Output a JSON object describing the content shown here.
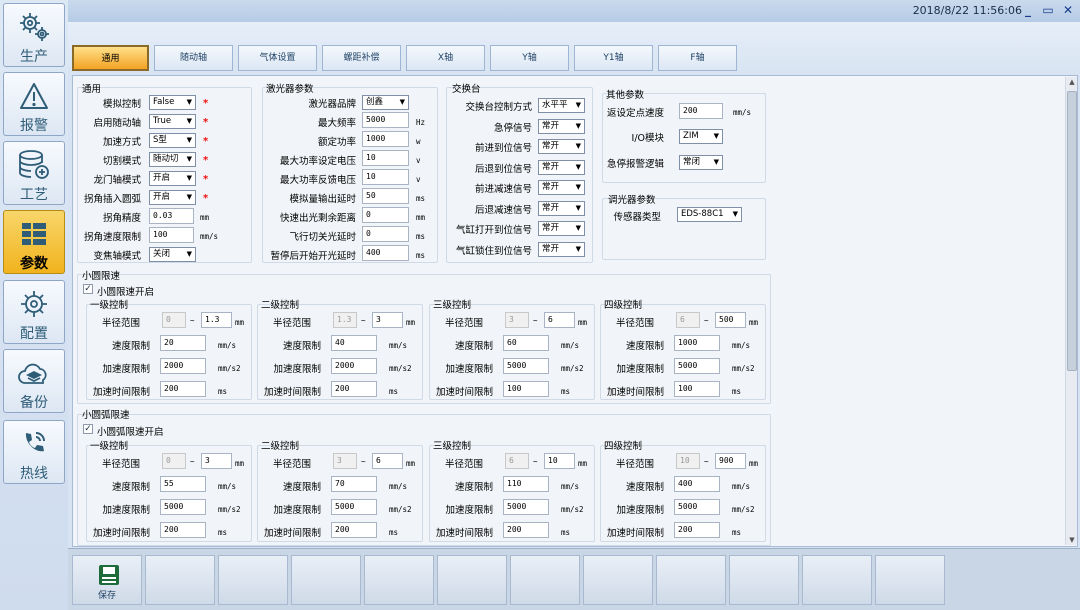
{
  "colors": {
    "accent": "#f1b31d",
    "brand": "#2f5d78",
    "required": "#ee1111"
  },
  "sidebar": {
    "items": [
      {
        "label": "生产",
        "icon": "gear-cluster-icon"
      },
      {
        "label": "报警",
        "icon": "warning-icon"
      },
      {
        "label": "工艺",
        "icon": "database-add-icon"
      },
      {
        "label": "参数",
        "icon": "grid-list-icon",
        "active": true
      },
      {
        "label": "配置",
        "icon": "gear-icon"
      },
      {
        "label": "备份",
        "icon": "cloud-backup-icon"
      },
      {
        "label": "热线",
        "icon": "phone-icon"
      }
    ]
  },
  "header": {
    "datetime": "2018/8/22 11:56:06"
  },
  "tabs": [
    "通用",
    "随动轴",
    "气体设置",
    "螺距补偿",
    "X轴",
    "Y轴",
    "Y1轴",
    "F轴"
  ],
  "general": {
    "title": "通用",
    "rows": [
      {
        "label": "模拟控制",
        "value": "False",
        "type": "dd",
        "req": "*"
      },
      {
        "label": "启用随动轴",
        "value": "True",
        "type": "dd",
        "req": "*"
      },
      {
        "label": "加速方式",
        "value": "S型",
        "type": "dd",
        "req": "*"
      },
      {
        "label": "切割模式",
        "value": "随动切",
        "type": "dd",
        "req": "*"
      },
      {
        "label": "龙门轴模式",
        "value": "开启",
        "type": "dd",
        "req": "*"
      },
      {
        "label": "拐角插入圆弧",
        "value": "开启",
        "type": "dd",
        "req": "*"
      },
      {
        "label": "拐角精度",
        "value": "0.03",
        "type": "tb",
        "unit": "mm"
      },
      {
        "label": "拐角速度限制",
        "value": "100",
        "type": "tb",
        "unit": "mm/s"
      },
      {
        "label": "变焦轴模式",
        "value": "关闭",
        "type": "dd"
      }
    ]
  },
  "laser": {
    "title": "激光器参数",
    "rows": [
      {
        "label": "激光器品牌",
        "value": "创鑫",
        "type": "dd"
      },
      {
        "label": "最大频率",
        "value": "5000",
        "type": "tb",
        "unit": "Hz"
      },
      {
        "label": "额定功率",
        "value": "1000",
        "type": "tb",
        "unit": "w"
      },
      {
        "label": "最大功率设定电压",
        "value": "10",
        "type": "tb",
        "unit": "v"
      },
      {
        "label": "最大功率反馈电压",
        "value": "10",
        "type": "tb",
        "unit": "v"
      },
      {
        "label": "模拟量输出延时",
        "value": "50",
        "type": "tb",
        "unit": "ms"
      },
      {
        "label": "快速出光剩余距离",
        "value": "0",
        "type": "tb",
        "unit": "mm"
      },
      {
        "label": "飞行切关光延时",
        "value": "0",
        "type": "tb",
        "unit": "ms"
      },
      {
        "label": "暂停后开始开光延时",
        "value": "400",
        "type": "tb",
        "unit": "ms"
      }
    ]
  },
  "exchange": {
    "title": "交换台",
    "rows": [
      {
        "label": "交换台控制方式",
        "value": "水平平"
      },
      {
        "label": "急停信号",
        "value": "常开"
      },
      {
        "label": "前进到位信号",
        "value": "常开"
      },
      {
        "label": "后退到位信号",
        "value": "常开"
      },
      {
        "label": "前进减速信号",
        "value": "常开"
      },
      {
        "label": "后退减速信号",
        "value": "常开"
      },
      {
        "label": "气缸打开到位信号",
        "value": "常开"
      },
      {
        "label": "气缸锁住到位信号",
        "value": "常开"
      }
    ]
  },
  "other": {
    "title": "其他参数",
    "rows": [
      {
        "label": "返设定点速度",
        "value": "200",
        "type": "tb",
        "unit": "mm/s"
      },
      {
        "label": "I/O模块",
        "value": "ZIM",
        "type": "dd"
      },
      {
        "label": "急停报警逻辑",
        "value": "常闭",
        "type": "dd"
      }
    ]
  },
  "dimmer": {
    "title": "调光器参数",
    "rows": [
      {
        "label": "传感器类型",
        "value": "EDS-88C1",
        "type": "dd"
      }
    ]
  },
  "circle": {
    "title": "小圆限速",
    "check_label": "小圆限速开启",
    "levels": [
      {
        "title": "一级控制",
        "rmin": "0",
        "rmax": "1.3",
        "speed": "20",
        "acc": "2000",
        "time": "200"
      },
      {
        "title": "二级控制",
        "rmin": "1.3",
        "rmax": "3",
        "speed": "40",
        "acc": "2000",
        "time": "200"
      },
      {
        "title": "三级控制",
        "rmin": "3",
        "rmax": "6",
        "speed": "60",
        "acc": "5000",
        "time": "100"
      },
      {
        "title": "四级控制",
        "rmin": "6",
        "rmax": "500",
        "speed": "1000",
        "acc": "5000",
        "time": "100"
      }
    ]
  },
  "arc": {
    "title": "小圆弧限速",
    "check_label": "小圆弧限速开启",
    "levels": [
      {
        "title": "一级控制",
        "rmin": "0",
        "rmax": "3",
        "speed": "55",
        "acc": "5000",
        "time": "200"
      },
      {
        "title": "二级控制",
        "rmin": "3",
        "rmax": "6",
        "speed": "70",
        "acc": "5000",
        "time": "200"
      },
      {
        "title": "三级控制",
        "rmin": "6",
        "rmax": "10",
        "speed": "110",
        "acc": "5000",
        "time": "200"
      },
      {
        "title": "四级控制",
        "rmin": "10",
        "rmax": "900",
        "speed": "400",
        "acc": "5000",
        "time": "200"
      }
    ]
  },
  "level_labels": {
    "radius": "半径范围",
    "speed": "速度限制",
    "acc": "加速度限制",
    "time": "加速时间限制",
    "tilde": "~"
  },
  "units": {
    "mm": "mm",
    "speed": "mm/s",
    "acc": "mm/s2",
    "time": "ms"
  },
  "bottom": {
    "save_label": "保存"
  }
}
